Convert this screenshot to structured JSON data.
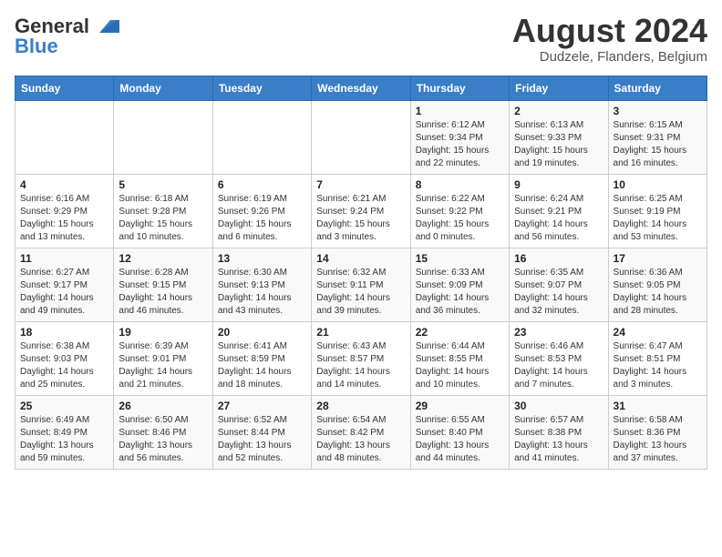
{
  "header": {
    "logo_general": "General",
    "logo_blue": "Blue",
    "title": "August 2024",
    "subtitle": "Dudzele, Flanders, Belgium"
  },
  "weekdays": [
    "Sunday",
    "Monday",
    "Tuesday",
    "Wednesday",
    "Thursday",
    "Friday",
    "Saturday"
  ],
  "weeks": [
    [
      {
        "day": "",
        "info": ""
      },
      {
        "day": "",
        "info": ""
      },
      {
        "day": "",
        "info": ""
      },
      {
        "day": "",
        "info": ""
      },
      {
        "day": "1",
        "info": "Sunrise: 6:12 AM\nSunset: 9:34 PM\nDaylight: 15 hours\nand 22 minutes."
      },
      {
        "day": "2",
        "info": "Sunrise: 6:13 AM\nSunset: 9:33 PM\nDaylight: 15 hours\nand 19 minutes."
      },
      {
        "day": "3",
        "info": "Sunrise: 6:15 AM\nSunset: 9:31 PM\nDaylight: 15 hours\nand 16 minutes."
      }
    ],
    [
      {
        "day": "4",
        "info": "Sunrise: 6:16 AM\nSunset: 9:29 PM\nDaylight: 15 hours\nand 13 minutes."
      },
      {
        "day": "5",
        "info": "Sunrise: 6:18 AM\nSunset: 9:28 PM\nDaylight: 15 hours\nand 10 minutes."
      },
      {
        "day": "6",
        "info": "Sunrise: 6:19 AM\nSunset: 9:26 PM\nDaylight: 15 hours\nand 6 minutes."
      },
      {
        "day": "7",
        "info": "Sunrise: 6:21 AM\nSunset: 9:24 PM\nDaylight: 15 hours\nand 3 minutes."
      },
      {
        "day": "8",
        "info": "Sunrise: 6:22 AM\nSunset: 9:22 PM\nDaylight: 15 hours\nand 0 minutes."
      },
      {
        "day": "9",
        "info": "Sunrise: 6:24 AM\nSunset: 9:21 PM\nDaylight: 14 hours\nand 56 minutes."
      },
      {
        "day": "10",
        "info": "Sunrise: 6:25 AM\nSunset: 9:19 PM\nDaylight: 14 hours\nand 53 minutes."
      }
    ],
    [
      {
        "day": "11",
        "info": "Sunrise: 6:27 AM\nSunset: 9:17 PM\nDaylight: 14 hours\nand 49 minutes."
      },
      {
        "day": "12",
        "info": "Sunrise: 6:28 AM\nSunset: 9:15 PM\nDaylight: 14 hours\nand 46 minutes."
      },
      {
        "day": "13",
        "info": "Sunrise: 6:30 AM\nSunset: 9:13 PM\nDaylight: 14 hours\nand 43 minutes."
      },
      {
        "day": "14",
        "info": "Sunrise: 6:32 AM\nSunset: 9:11 PM\nDaylight: 14 hours\nand 39 minutes."
      },
      {
        "day": "15",
        "info": "Sunrise: 6:33 AM\nSunset: 9:09 PM\nDaylight: 14 hours\nand 36 minutes."
      },
      {
        "day": "16",
        "info": "Sunrise: 6:35 AM\nSunset: 9:07 PM\nDaylight: 14 hours\nand 32 minutes."
      },
      {
        "day": "17",
        "info": "Sunrise: 6:36 AM\nSunset: 9:05 PM\nDaylight: 14 hours\nand 28 minutes."
      }
    ],
    [
      {
        "day": "18",
        "info": "Sunrise: 6:38 AM\nSunset: 9:03 PM\nDaylight: 14 hours\nand 25 minutes."
      },
      {
        "day": "19",
        "info": "Sunrise: 6:39 AM\nSunset: 9:01 PM\nDaylight: 14 hours\nand 21 minutes."
      },
      {
        "day": "20",
        "info": "Sunrise: 6:41 AM\nSunset: 8:59 PM\nDaylight: 14 hours\nand 18 minutes."
      },
      {
        "day": "21",
        "info": "Sunrise: 6:43 AM\nSunset: 8:57 PM\nDaylight: 14 hours\nand 14 minutes."
      },
      {
        "day": "22",
        "info": "Sunrise: 6:44 AM\nSunset: 8:55 PM\nDaylight: 14 hours\nand 10 minutes."
      },
      {
        "day": "23",
        "info": "Sunrise: 6:46 AM\nSunset: 8:53 PM\nDaylight: 14 hours\nand 7 minutes."
      },
      {
        "day": "24",
        "info": "Sunrise: 6:47 AM\nSunset: 8:51 PM\nDaylight: 14 hours\nand 3 minutes."
      }
    ],
    [
      {
        "day": "25",
        "info": "Sunrise: 6:49 AM\nSunset: 8:49 PM\nDaylight: 13 hours\nand 59 minutes."
      },
      {
        "day": "26",
        "info": "Sunrise: 6:50 AM\nSunset: 8:46 PM\nDaylight: 13 hours\nand 56 minutes."
      },
      {
        "day": "27",
        "info": "Sunrise: 6:52 AM\nSunset: 8:44 PM\nDaylight: 13 hours\nand 52 minutes."
      },
      {
        "day": "28",
        "info": "Sunrise: 6:54 AM\nSunset: 8:42 PM\nDaylight: 13 hours\nand 48 minutes."
      },
      {
        "day": "29",
        "info": "Sunrise: 6:55 AM\nSunset: 8:40 PM\nDaylight: 13 hours\nand 44 minutes."
      },
      {
        "day": "30",
        "info": "Sunrise: 6:57 AM\nSunset: 8:38 PM\nDaylight: 13 hours\nand 41 minutes."
      },
      {
        "day": "31",
        "info": "Sunrise: 6:58 AM\nSunset: 8:36 PM\nDaylight: 13 hours\nand 37 minutes."
      }
    ]
  ]
}
